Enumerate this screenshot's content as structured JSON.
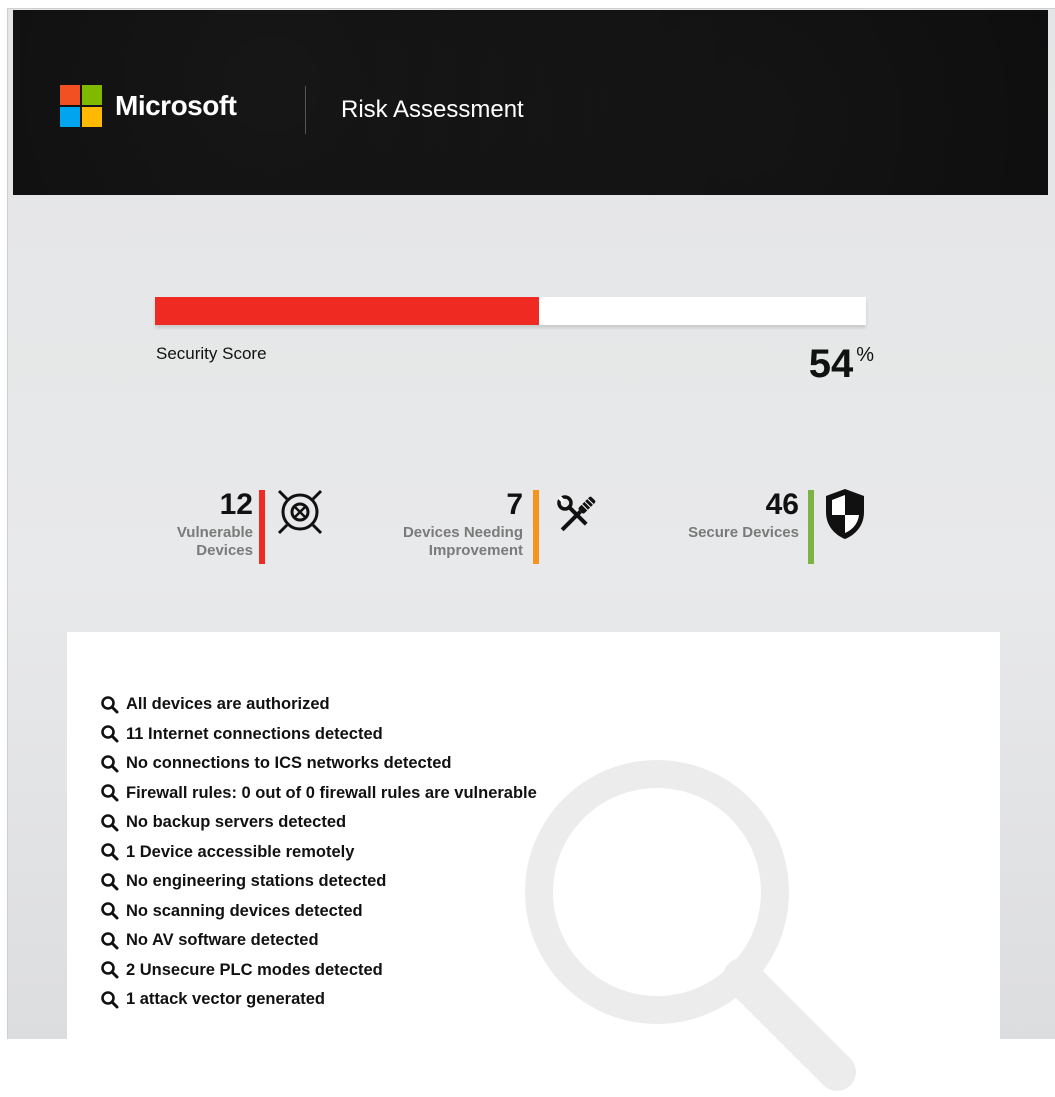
{
  "header": {
    "brand": "Microsoft",
    "title": "Risk Assessment",
    "logo_colors": [
      "#f25022",
      "#7fba00",
      "#00a4ef",
      "#ffb900"
    ]
  },
  "score": {
    "label": "Security Score",
    "value": "54",
    "unit": "%",
    "fraction": 0.54,
    "fill_color": "#ee2a23"
  },
  "stats": [
    {
      "count": "12",
      "label_line1": "Vulnerable",
      "label_line2": "Devices",
      "color": "#ee2a23",
      "icon": "target-cross-icon"
    },
    {
      "count": "7",
      "label_line1": "Devices Needing",
      "label_line2": "Improvement",
      "color": "#f7941d",
      "icon": "tools-icon"
    },
    {
      "count": "46",
      "label_line1": "Secure Devices",
      "label_line2": "",
      "color": "#7cb342",
      "icon": "shield-icon"
    }
  ],
  "findings": [
    "All devices are authorized",
    "11 Internet connections detected",
    "No connections to ICS networks detected",
    "Firewall rules: 0 out of 0 firewall rules are vulnerable",
    "No backup servers detected",
    "1 Device accessible remotely",
    "No engineering stations detected",
    "No scanning devices detected",
    "No AV software detected",
    "2 Unsecure PLC modes detected",
    "1 attack vector generated"
  ],
  "findings_icon": "magnifier-icon"
}
